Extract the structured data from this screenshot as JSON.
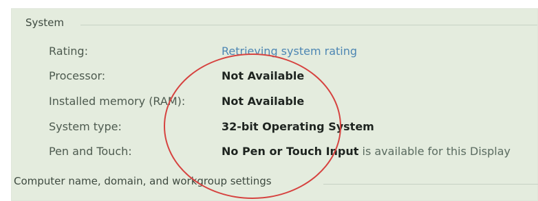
{
  "system_group": {
    "title": "System",
    "rows": [
      {
        "label": "Rating:",
        "value": "Retrieving system rating",
        "style": "link"
      },
      {
        "label": "Processor:",
        "value": "Not Available",
        "style": "strong"
      },
      {
        "label": "Installed memory (RAM):",
        "value": "Not Available",
        "style": "strong"
      },
      {
        "label": "System type:",
        "value": "32-bit Operating System",
        "style": "strong"
      },
      {
        "label": "Pen and Touch:",
        "value": "No Pen or Touch Input",
        "value_rest": " is available for this Display",
        "style": "strong"
      }
    ]
  },
  "computer_group": {
    "title": "Computer name, domain, and workgroup settings"
  },
  "colors": {
    "panel_bg": "#e4ecde",
    "link": "#4d86b3",
    "annotation_circle": "#d6423f"
  }
}
